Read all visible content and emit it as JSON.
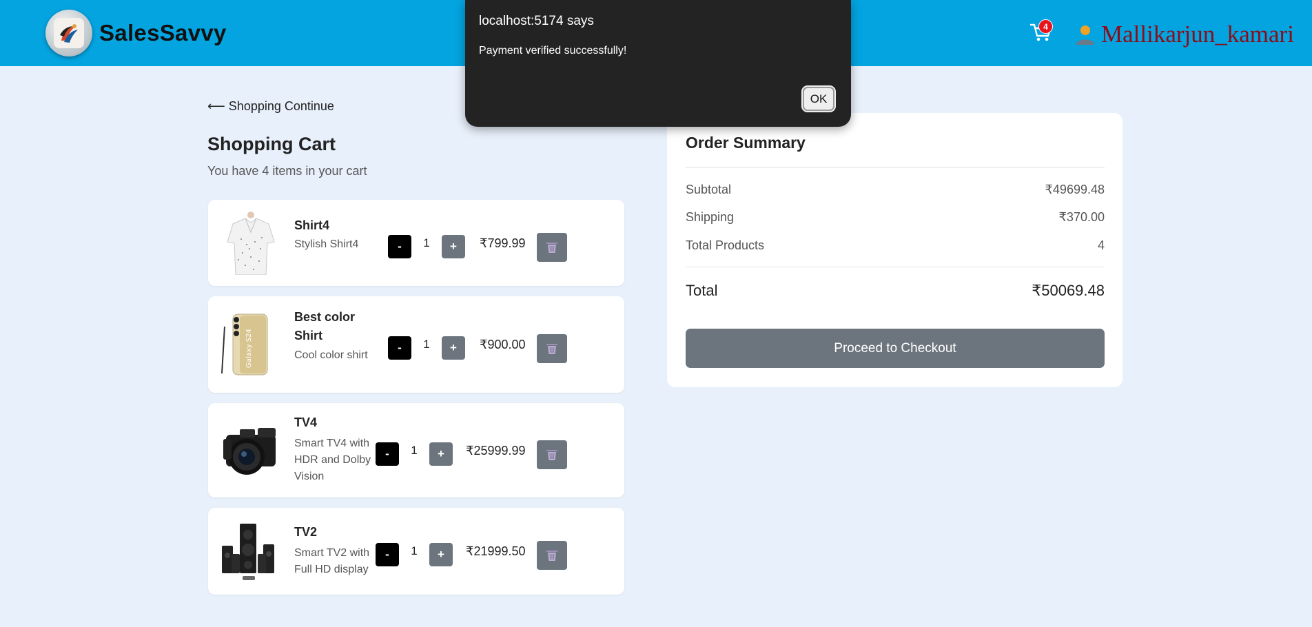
{
  "header": {
    "brand": "SalesSavvy",
    "cart_count": "4",
    "username": "Mallikarjun_kamari",
    "bg_color": "#03a4e0"
  },
  "nav": {
    "back_label": "⟵ Shopping Continue"
  },
  "cart": {
    "title": "Shopping Cart",
    "subtitle": "You have 4 items in your cart",
    "items": [
      {
        "name": "Shirt4",
        "desc": "Stylish Shirt4",
        "qty": "1",
        "price": "₹799.99",
        "image": "shirt-image"
      },
      {
        "name": "Best color Shirt",
        "desc": "Cool color shirt",
        "qty": "1",
        "price": "₹900.00",
        "image": "phone-image"
      },
      {
        "name": "TV4",
        "desc": "Smart TV4 with HDR and Dolby Vision",
        "qty": "1",
        "price": "₹25999.99",
        "image": "camera-image"
      },
      {
        "name": "TV2",
        "desc": "Smart TV2 with Full HD display",
        "qty": "1",
        "price": "₹21999.50",
        "image": "speaker-image"
      }
    ],
    "minus_label": "-",
    "plus_label": "+"
  },
  "summary": {
    "title": "Order Summary",
    "rows": [
      {
        "label": "Subtotal",
        "value": "₹49699.48"
      },
      {
        "label": "Shipping",
        "value": "₹370.00"
      },
      {
        "label": "Total Products",
        "value": "4"
      }
    ],
    "total_label": "Total",
    "total_value": "₹50069.48",
    "checkout_label": "Proceed to Checkout"
  },
  "dialog": {
    "title": "localhost:5174 says",
    "message": "Payment verified successfully!",
    "ok_label": "OK"
  }
}
